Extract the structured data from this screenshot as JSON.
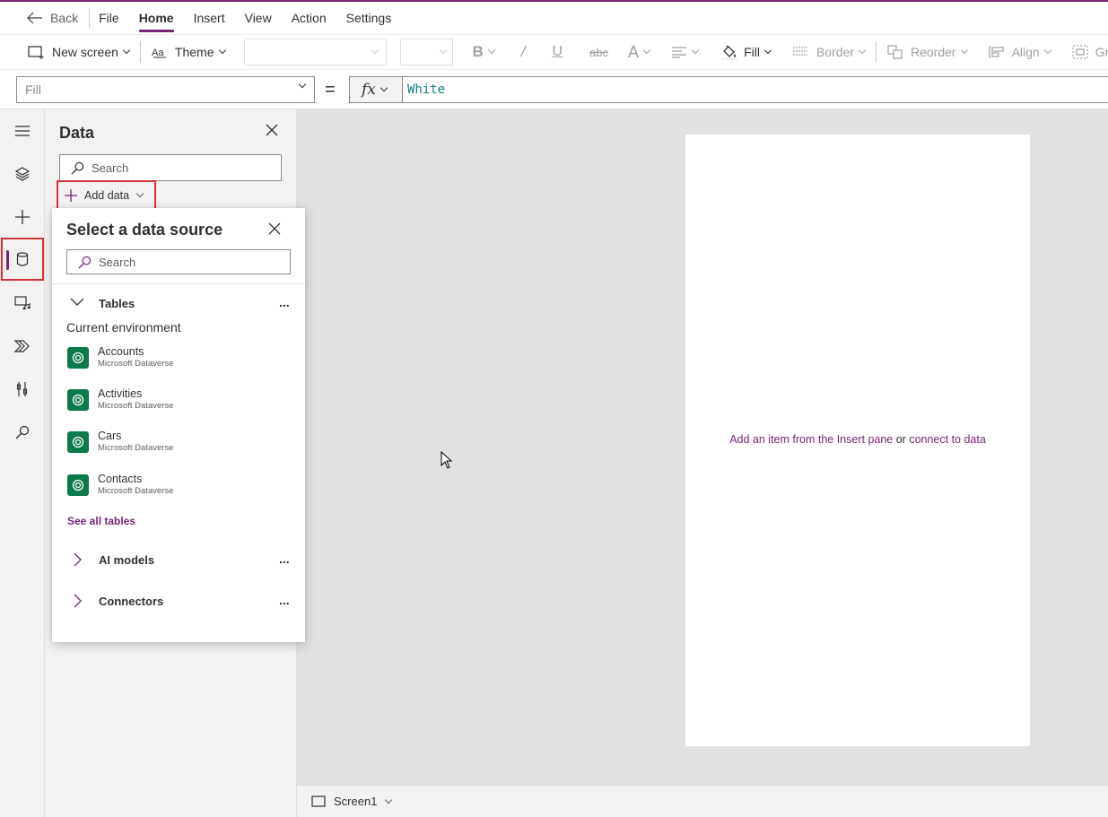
{
  "menubar": {
    "back_label": "Back",
    "items": [
      "File",
      "Home",
      "Insert",
      "View",
      "Action",
      "Settings"
    ],
    "active": "Home"
  },
  "toolbar": {
    "new_screen": "New screen",
    "theme": "Theme",
    "fill": "Fill",
    "border": "Border",
    "reorder": "Reorder",
    "align": "Align",
    "group": "Gro"
  },
  "formula": {
    "property": "Fill",
    "equals": "=",
    "fx": "fx",
    "value": "White"
  },
  "data_pane": {
    "title": "Data",
    "search_placeholder": "Search",
    "add_data_label": "Add data"
  },
  "popup": {
    "title": "Select a data source",
    "search_placeholder": "Search",
    "tables_label": "Tables",
    "environment_label": "Current environment",
    "tables": [
      {
        "name": "Accounts",
        "source": "Microsoft Dataverse"
      },
      {
        "name": "Activities",
        "source": "Microsoft Dataverse"
      },
      {
        "name": "Cars",
        "source": "Microsoft Dataverse"
      },
      {
        "name": "Contacts",
        "source": "Microsoft Dataverse"
      }
    ],
    "see_all": "See all tables",
    "ai_models_label": "AI models",
    "connectors_label": "Connectors",
    "more": "..."
  },
  "canvas": {
    "hint_part1": "Add an item from the Insert pane",
    "hint_or": " or ",
    "hint_part2": "connect to data"
  },
  "status": {
    "screen_name": "Screen1"
  },
  "colors": {
    "accent": "#742774",
    "highlight": "#d13438",
    "dataverse": "#0b7a4b",
    "formula_text": "#107c7c"
  }
}
